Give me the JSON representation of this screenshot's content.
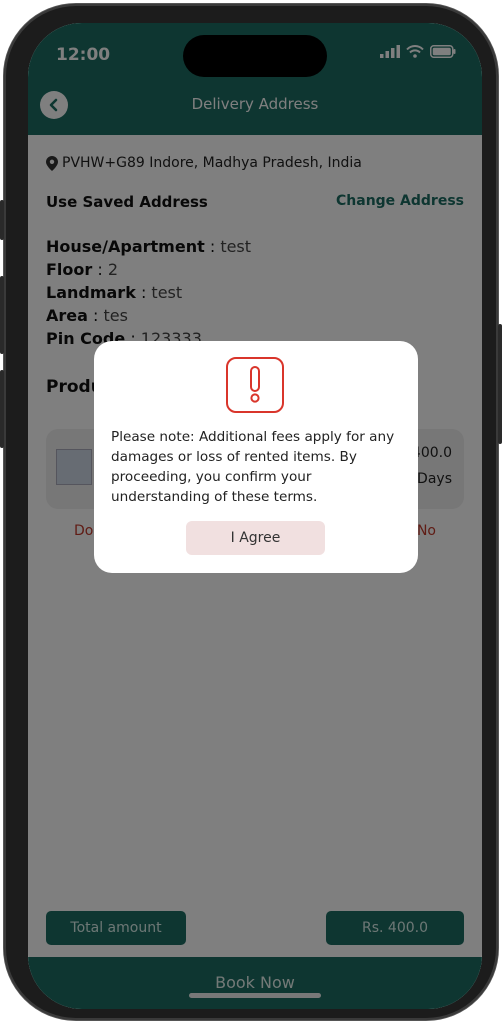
{
  "status_bar": {
    "time": "12:00"
  },
  "header": {
    "title": "Delivery Address"
  },
  "location": {
    "text": "PVHW+G89 Indore, Madhya Pradesh, India"
  },
  "saved_address": {
    "label": "Use Saved Address",
    "change_label": "Change Address"
  },
  "address_fields": [
    {
      "key": "House/Apartment",
      "sep": ":",
      "value": "test"
    },
    {
      "key": "Floor",
      "sep": ":",
      "value": "2"
    },
    {
      "key": "Landmark",
      "sep": ":",
      "value": "test"
    },
    {
      "key": "Area",
      "sep": ":",
      "value": "tes"
    },
    {
      "key": "Pin Code",
      "sep": ":",
      "value": "123333"
    }
  ],
  "products": {
    "title": "Produ",
    "item": {
      "price_fragment": "400.0",
      "days_fragment": "Days"
    },
    "left_fragment": "Do",
    "right_fragment": "No"
  },
  "footer": {
    "total_label": "Total amount",
    "amount": "Rs. 400.0",
    "book_now": "Book Now"
  },
  "dialog": {
    "icon": "exclamation-icon",
    "message": "Please note: Additional fees apply for any damages or loss of rented items. By proceeding, you confirm your understanding of these terms.",
    "agree_label": "I Agree"
  },
  "colors": {
    "brand": "#1d6d63",
    "alert_red": "#d9352b",
    "agree_bg": "#f1e0e0"
  }
}
